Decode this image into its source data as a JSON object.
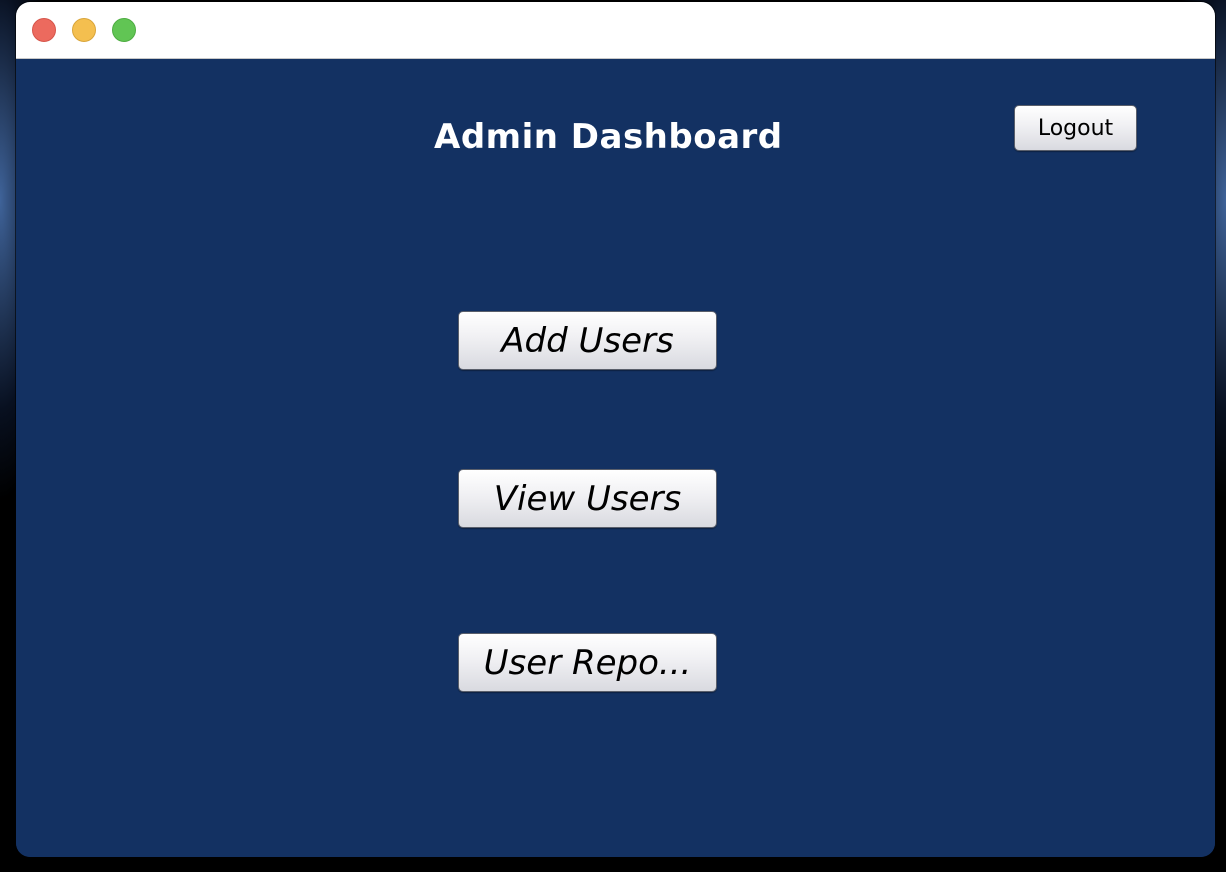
{
  "titlebar": {
    "buttons": [
      "close",
      "minimize",
      "zoom"
    ]
  },
  "header": {
    "title": "Admin Dashboard",
    "logout_label": "Logout"
  },
  "actions": {
    "add_users_label": "Add Users",
    "view_users_label": "View Users",
    "user_reports_label": "User Repo..."
  },
  "colors": {
    "background": "#133162",
    "title_text": "#ffffff",
    "close": "#ec6a5e",
    "minimize": "#f4bf4f",
    "zoom": "#61c554"
  }
}
